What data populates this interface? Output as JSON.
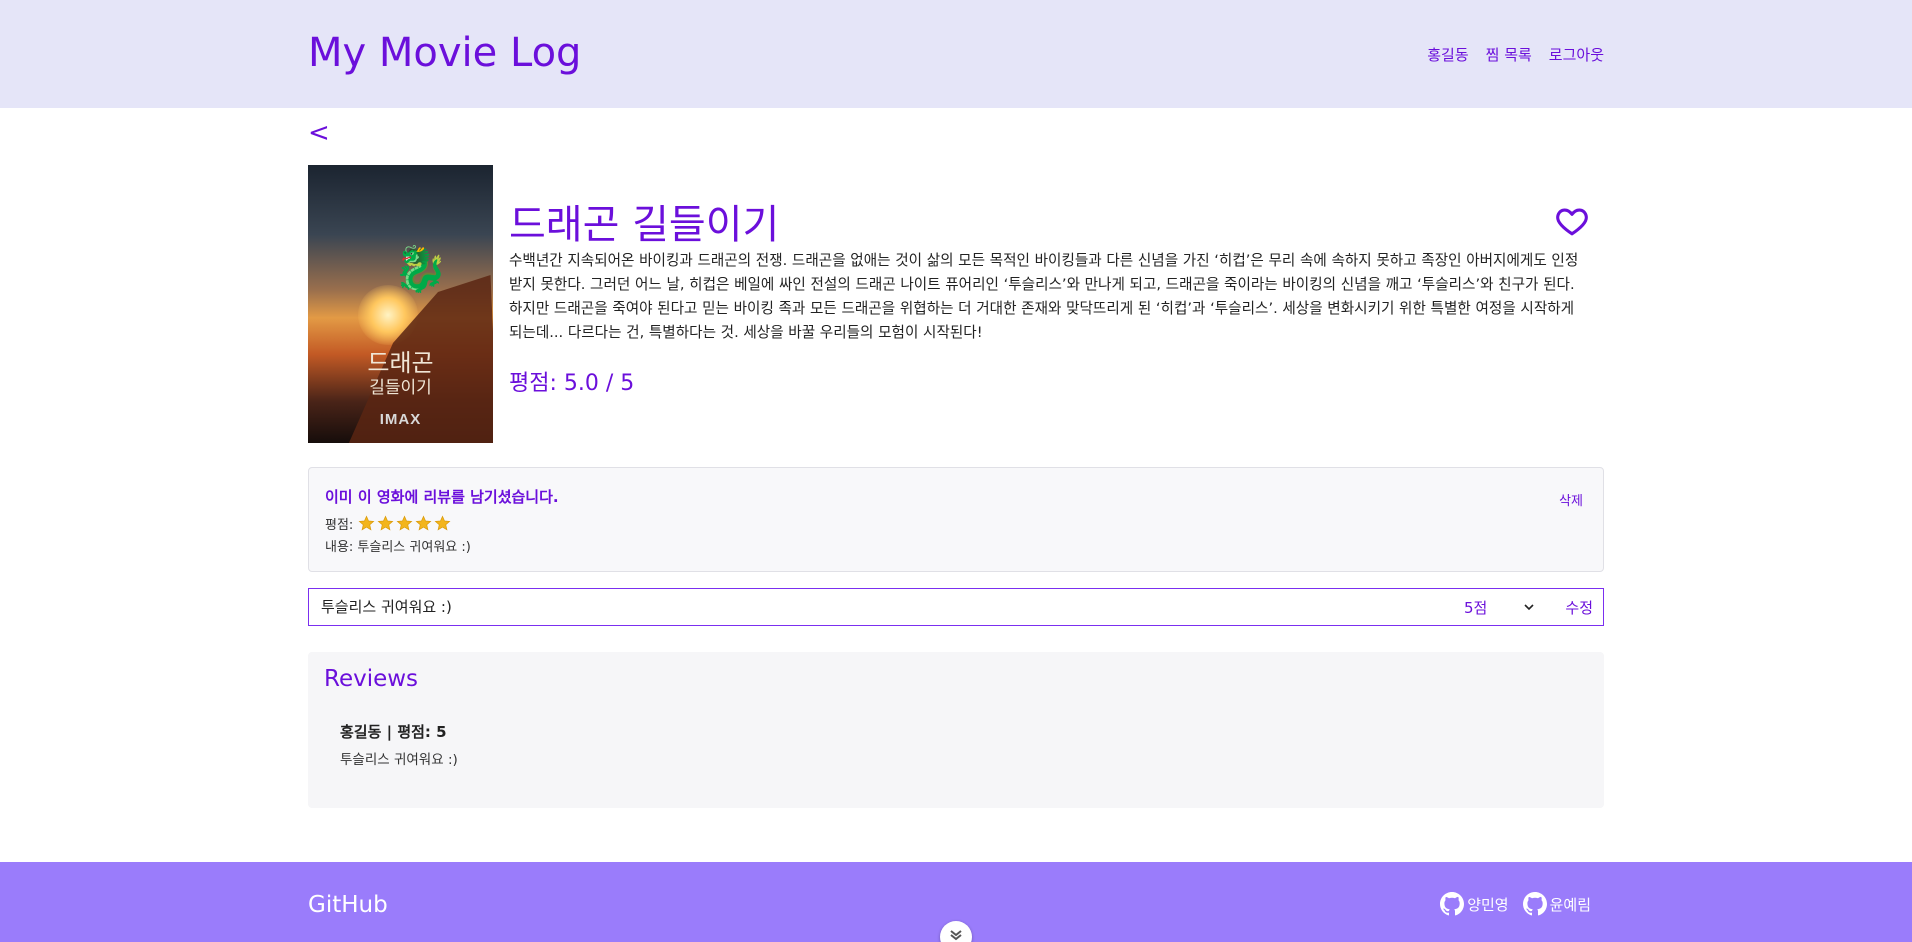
{
  "header": {
    "site_title": "My Movie Log",
    "nav": [
      "홍길동",
      "찜 목록",
      "로그아웃"
    ]
  },
  "back_label": "<",
  "movie": {
    "title": "드래곤 길들이기",
    "description": "수백년간 지속되어온 바이킹과 드래곤의 전쟁. 드래곤을 없애는 것이 삶의 모든 목적인 바이킹들과 다른 신념을 가진 ‘히컵’은 무리 속에 속하지 못하고 족장인 아버지에게도 인정받지 못한다. 그러던 어느 날, 히컵은 베일에 싸인 전설의 드래곤 나이트 퓨어리인 ‘투슬리스’와 만나게 되고, 드래곤을 죽이라는 바이킹의 신념을 깨고 ‘투슬리스’와 친구가 된다. 하지만 드래곤을 죽여야 된다고 믿는 바이킹 족과 모든 드래곤을 위협하는 더 거대한 존재와 맞닥뜨리게 된 ‘히컵’과 ‘투슬리스’. 세상을 변화시키기 위한 특별한 여정을 시작하게 되는데... 다르다는 건, 특별하다는 것. 세상을 바꿀 우리들의 모험이 시작된다!",
    "rating_text": "평점: 5.0 / 5",
    "poster": {
      "title": "드래곤",
      "subtitle": "길들이기",
      "badge": "IMAX"
    }
  },
  "my_review": {
    "notice": "이미 이 영화에 리뷰를 남기셨습니다.",
    "delete_label": "삭제",
    "score_label": "평점:",
    "stars": 5,
    "content_text": "내용: 투슬리스 귀여워요 :)"
  },
  "edit_form": {
    "input_value": "투슬리스 귀여워요 :)",
    "select_value": "5점",
    "submit_label": "수정"
  },
  "reviews": {
    "title": "Reviews",
    "items": [
      {
        "header": "홍길동 | 평점: 5",
        "body": "투슬리스 귀여워요 :)"
      }
    ]
  },
  "footer": {
    "title": "GitHub",
    "links": [
      "양민영",
      "윤예림"
    ]
  },
  "colors": {
    "accent": "#6b0fdb",
    "header_bg": "#e5e5f8",
    "footer_bg": "#9a7cfb",
    "star": "#f3b51c"
  }
}
